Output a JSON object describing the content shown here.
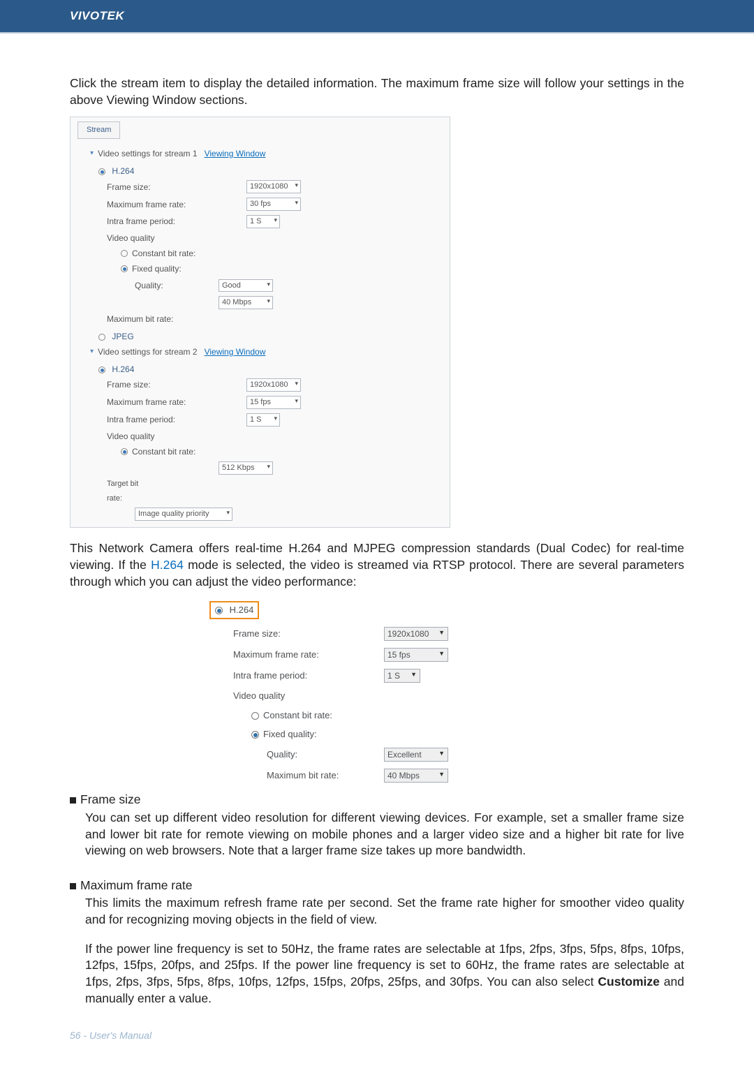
{
  "brand": "VIVOTEK",
  "intro": "Click the stream item to display the detailed information. The maximum frame size will follow your settings in the above Viewing Window sections.",
  "shot1": {
    "tab": "Stream",
    "s1_header": "Video settings for stream 1",
    "viewing_link": "Viewing Window",
    "h264": "H.264",
    "frame_size_lbl": "Frame size:",
    "frame_size_val1": "1920x1080",
    "max_fr_lbl": "Maximum frame rate:",
    "max_fr_val1": "30 fps",
    "intra_lbl": "Intra frame period:",
    "intra_val1": "1 S",
    "vq_lbl": "Video quality",
    "cbr_lbl": "Constant bit rate:",
    "fq_lbl": "Fixed quality:",
    "quality_lbl": "Quality:",
    "quality_val": "Good",
    "mbr_val": "40 Mbps",
    "max_br_lbl": "Maximum bit rate:",
    "jpeg": "JPEG",
    "s2_header": "Video settings for stream 2",
    "frame_size_val2": "1920x1080",
    "max_fr_val2": "15 fps",
    "intra_val2": "1 S",
    "cbr_sel": "512 Kbps",
    "target_bit": "Target bit",
    "rate": "rate:",
    "imgqp": "Image quality priority"
  },
  "mid1": "This Network Camera offers real-time H.264 and MJPEG compression standards (Dual Codec) for real-time viewing. If the ",
  "mid_link": "H.264",
  "mid2": " mode is selected, the video is streamed via RTSP protocol. There are several parameters through which you can adjust the video performance:",
  "shot2": {
    "h264": "H.264",
    "frame_size_lbl": "Frame size:",
    "frame_size_val": "1920x1080",
    "max_fr_lbl": "Maximum frame rate:",
    "max_fr_val": "15 fps",
    "intra_lbl": "Intra frame period:",
    "intra_val": "1 S",
    "vq_lbl": "Video quality",
    "cbr_lbl": "Constant bit rate:",
    "fq_lbl": "Fixed quality:",
    "quality_lbl": "Quality:",
    "quality_val": "Excellent",
    "mbr_lbl": "Maximum bit rate:",
    "mbr_val": "40 Mbps"
  },
  "b1_head": "Frame size",
  "b1_body": "You can set up different video resolution for different viewing devices. For example, set a smaller frame size and lower bit rate for remote viewing on mobile phones and a larger video size and a higher bit rate for live viewing on web browsers. Note that a larger frame size takes up more bandwidth.",
  "b2_head": "Maximum frame rate",
  "b2_body1": "This limits the maximum refresh frame rate per second. Set the frame rate higher for smoother video quality and for recognizing moving objects in the field of view.",
  "b2_body2a": "If the power line frequency is set to 50Hz, the frame rates are selectable at 1fps, 2fps, 3fps, 5fps, 8fps, 10fps, 12fps, 15fps, 20fps, and 25fps. If the power line frequency is set to 60Hz, the frame rates are selectable at 1fps, 2fps, 3fps, 5fps, 8fps, 10fps, 12fps, 15fps, 20fps, 25fps, and 30fps. You can also select ",
  "b2_customize": "Customize",
  "b2_body2b": " and manually enter a value.",
  "footer": "56 - User's Manual"
}
